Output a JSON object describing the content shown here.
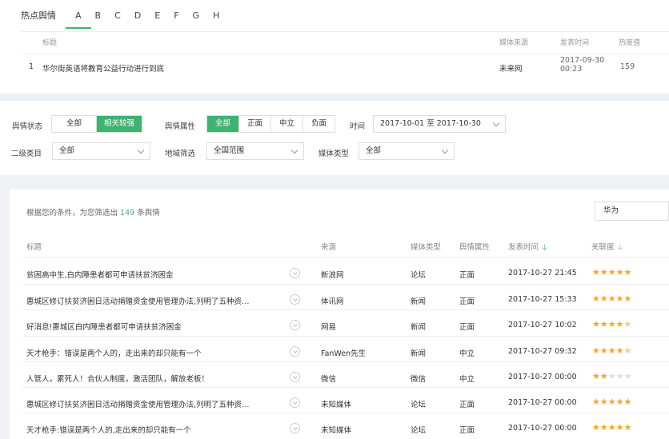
{
  "hot": {
    "title": "热点舆情",
    "letters": [
      "A",
      "B",
      "C",
      "D",
      "E",
      "F",
      "G",
      "H"
    ],
    "headers": {
      "title": "标题",
      "source": "媒体来源",
      "time": "发表时间",
      "heat": "热度值"
    },
    "row": {
      "index": "1",
      "title": "华尔街英语将教育公益行动进行到底",
      "source": "未来网",
      "time1": "2017-09-30",
      "time2": "00:23",
      "heat": "159"
    }
  },
  "filters": {
    "status_label": "舆情状态",
    "status_options": [
      "全部",
      "相关较强"
    ],
    "attr_label": "舆情属性",
    "attr_options": [
      "全部",
      "正面",
      "中立",
      "负面"
    ],
    "time_label": "时间",
    "time_value": "2017-10-01 至 2017-10-30",
    "cat_label": "二级类目",
    "cat_value": "全部",
    "region_label": "地域筛选",
    "region_value": "全国范围",
    "media_label": "媒体类型",
    "media_value": "全部"
  },
  "result": {
    "prefix": "根据您的条件，为您筛选出",
    "count": "149",
    "suffix": "条舆情",
    "search_value": "华为"
  },
  "table": {
    "headers": {
      "title": "标题",
      "source": "来源",
      "media": "媒体类型",
      "attr": "舆情属性",
      "time": "发表时间",
      "relevance": "关联度"
    },
    "rows": [
      {
        "title": "贫困高中生,白内障患者都可申请扶贫济困金",
        "source": "新浪网",
        "media": "论坛",
        "attr": "正面",
        "time": "2017-10-27 21:45",
        "stars": 5
      },
      {
        "title": "惠城区修订扶贫济困日活动捐赠资金使用管理办法,列明了五种资…",
        "source": "体讯网",
        "media": "新闻",
        "attr": "正面",
        "time": "2017-10-27 15:33",
        "stars": 5
      },
      {
        "title": "好消息!惠城区白内障患者都可申请扶贫济困金",
        "source": "网易",
        "media": "新闻",
        "attr": "正面",
        "time": "2017-10-27 10:02",
        "stars": 4.5
      },
      {
        "title": "天才枪手：错误是两个人的，走出来的却只能有一个",
        "source": "FanWen先生",
        "media": "新闻",
        "attr": "中立",
        "time": "2017-10-27 09:32",
        "stars": 4.5
      },
      {
        "title": "人管人，累死人！合伙人制度，激活团队，解放老板！",
        "source": "微信",
        "media": "微信",
        "attr": "中立",
        "time": "2017-10-27 00:00",
        "stars": 2
      },
      {
        "title": "惠城区修订扶贫济困日活动捐赠资金使用管理办法,列明了五种资…",
        "source": "未知媒体",
        "media": "论坛",
        "attr": "正面",
        "time": "2017-10-27 00:00",
        "stars": 5
      },
      {
        "title": "天才枪手:错误是两个人的,走出来的却只能有一个",
        "source": "未知媒体",
        "media": "论坛",
        "attr": "正面",
        "time": "2017-10-27 00:00",
        "stars": 5
      }
    ]
  }
}
